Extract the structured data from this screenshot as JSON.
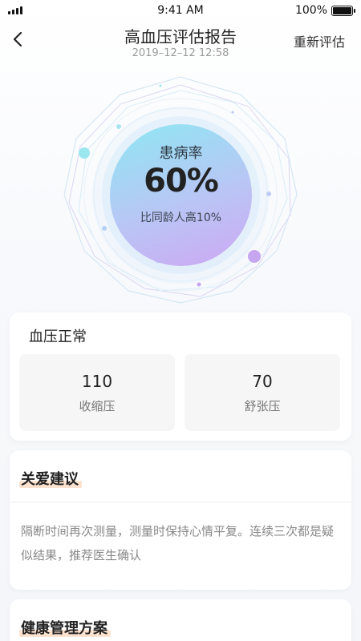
{
  "status_bar": {
    "time": "9:41 AM",
    "battery": "100%",
    "battery_level": 1.0
  },
  "nav": {
    "back_icon": "chevron-left-icon",
    "title": "高血压评估报告",
    "subtitle": "2019–12–12   12:58",
    "right_action": "重新评估"
  },
  "hero": {
    "label": "患病率",
    "value": "60%",
    "sub": "比同龄人高10%",
    "gradient_colors": [
      "#8ee7f2",
      "#b9c6f5",
      "#cda7f3"
    ]
  },
  "bp_card": {
    "title": "血压正常",
    "items": [
      {
        "value": "110",
        "label": "收缩压"
      },
      {
        "value": "70",
        "label": "舒张压"
      }
    ]
  },
  "care_card": {
    "title": "关爱建议",
    "text": "隔断时间再次测量，测量时保持心情平复。连续三次都是疑似结果，推荐医生确认"
  },
  "plan_card": {
    "title": "健康管理方案"
  },
  "colors": {
    "highlight": "#fde3cf",
    "card_bg": "#ffffff",
    "muted_text": "#888888"
  }
}
